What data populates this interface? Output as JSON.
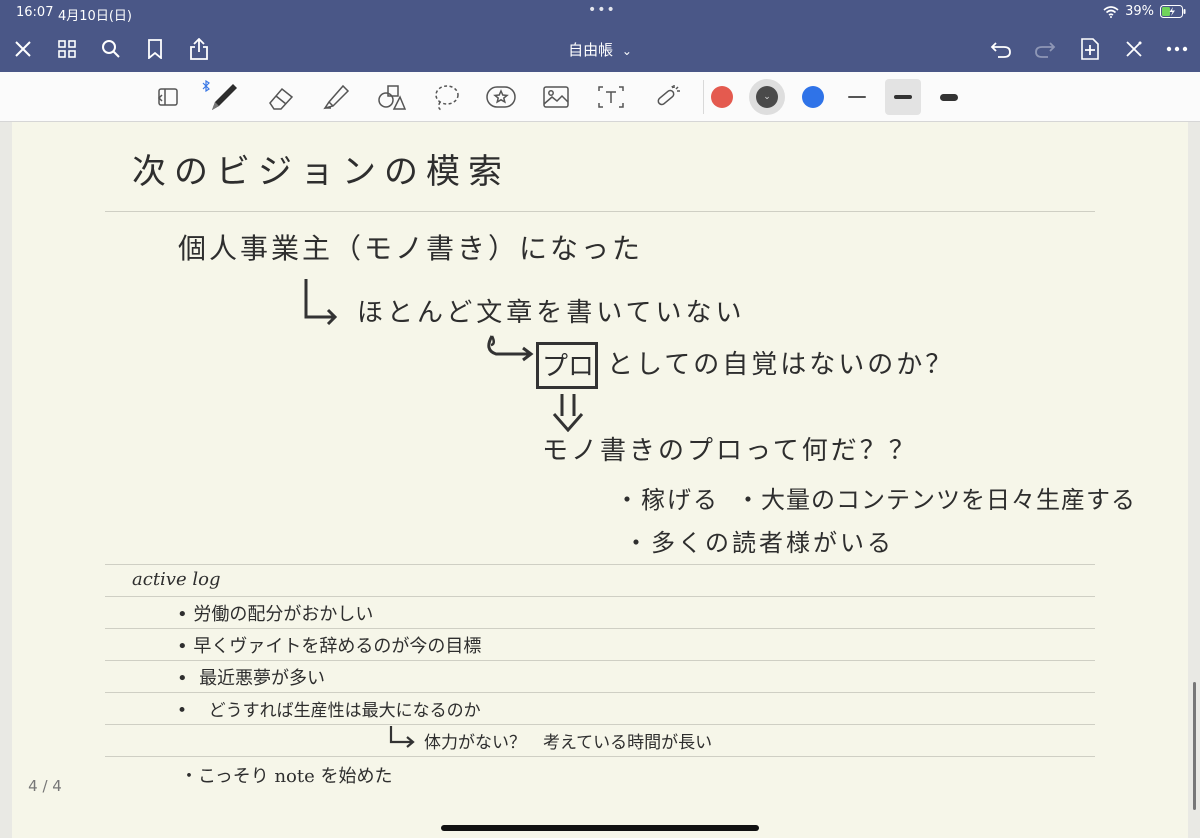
{
  "status": {
    "time": "16:07",
    "date": "4月10日(日)",
    "battery": "39%"
  },
  "nav": {
    "title": "自由帳",
    "title_caret": "⌄"
  },
  "toolbar": {
    "colors": [
      "#e45a4f",
      "#4a4a4a",
      "#2f73e8"
    ]
  },
  "note": {
    "heading": "次のビジョンの模索",
    "line1": "個人事業主（モノ書き）になった",
    "line2": "ほとんど文章を書いていない",
    "line3_box": "プロ",
    "line3": "としての自覚はないのか？",
    "line4": "モノ書きのプロって何だ？？",
    "line5a": "・稼げる",
    "line5b": "・大量のコンテンツを日々生産する",
    "line6": "・多くの読者様がいる",
    "log_title": "active log",
    "log_items": [
      "労働の配分がおかしい",
      "早くヴァイトを辞めるのが今の目標",
      "最近悪夢が多い",
      "どうすれば生産性は最大になるのか",
      "体力がない？　考えている時間が長い",
      "・こっそり note を始めた"
    ]
  },
  "page_indicator": "4 / 4"
}
